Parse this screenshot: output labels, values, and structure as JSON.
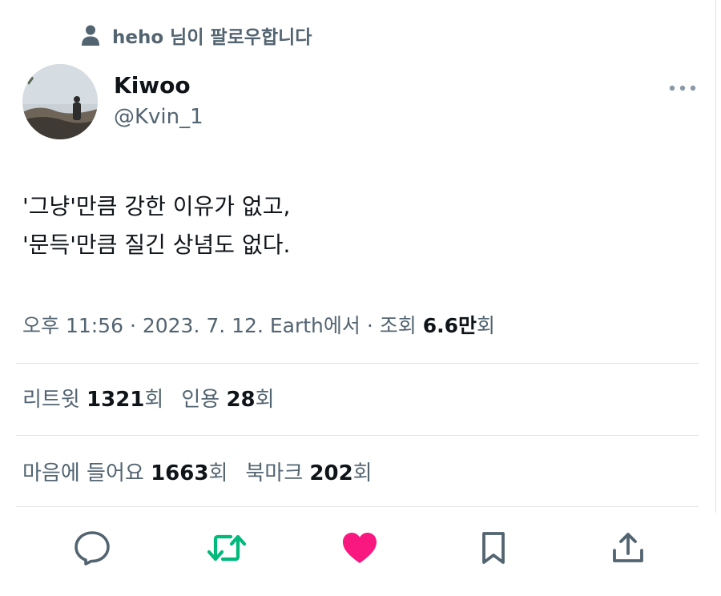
{
  "social_context": {
    "icon": "person-icon",
    "text": "heho 님이 팔로우합니다"
  },
  "author": {
    "display_name": "Kiwoo",
    "handle": "@Kvin_1"
  },
  "tweet": {
    "lines": [
      "'그냥'만큼 강한 이유가 없고,",
      "'문득'만큼 질긴 상념도 없다."
    ]
  },
  "meta": {
    "prefix": "오후 11:56 · 2023. 7. 12. Earth에서 · 조회 ",
    "views": "6.6만",
    "suffix": "회"
  },
  "stats": {
    "retweets_label": "리트윗 ",
    "retweets": "1321",
    "retweets_unit": "회",
    "quotes_label": "인용 ",
    "quotes": "28",
    "quotes_unit": "회",
    "likes_label": "마음에 들어요 ",
    "likes": "1663",
    "likes_unit": "회",
    "bookmarks_label": "북마크 ",
    "bookmarks": "202",
    "bookmarks_unit": "회"
  },
  "actions": [
    "reply-icon",
    "retweet-icon",
    "like-icon",
    "bookmark-icon",
    "share-icon"
  ],
  "colors": {
    "text_primary": "#0f1419",
    "text_secondary": "#536471",
    "retweet_active": "#00ba7c",
    "like_active": "#f91880",
    "divider": "#dfe3e6"
  }
}
